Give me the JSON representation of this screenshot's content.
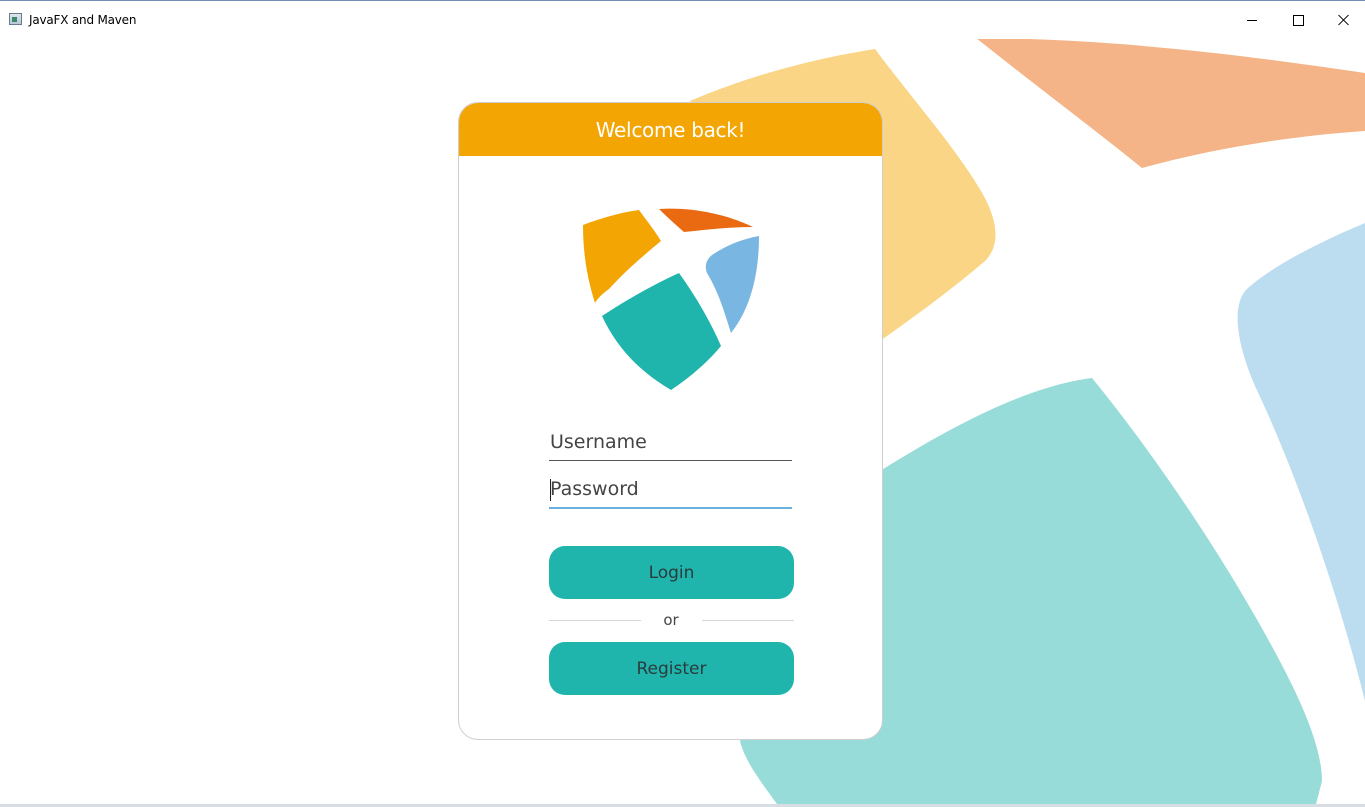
{
  "window": {
    "title": "JavaFX and Maven",
    "icon": "app-window-icon",
    "controls": [
      "minimize-icon",
      "maximize-icon",
      "close-icon"
    ]
  },
  "card": {
    "header_title": "Welcome back!",
    "logo": "shield-logo"
  },
  "form": {
    "username_placeholder": "Username",
    "password_placeholder": "Password",
    "login_label": "Login",
    "or_label": "or",
    "register_label": "Register"
  },
  "colors": {
    "header": "#f3a503",
    "button": "#20b5ac",
    "logo_orange": "#f3a503",
    "logo_red": "#e96a10",
    "logo_teal": "#20b5ac",
    "logo_blue": "#7ab6e2",
    "bg_yellow": "#fad586",
    "bg_peach": "#f4b487",
    "bg_teal": "#97dcd8",
    "bg_blue": "#bcdcf0"
  }
}
